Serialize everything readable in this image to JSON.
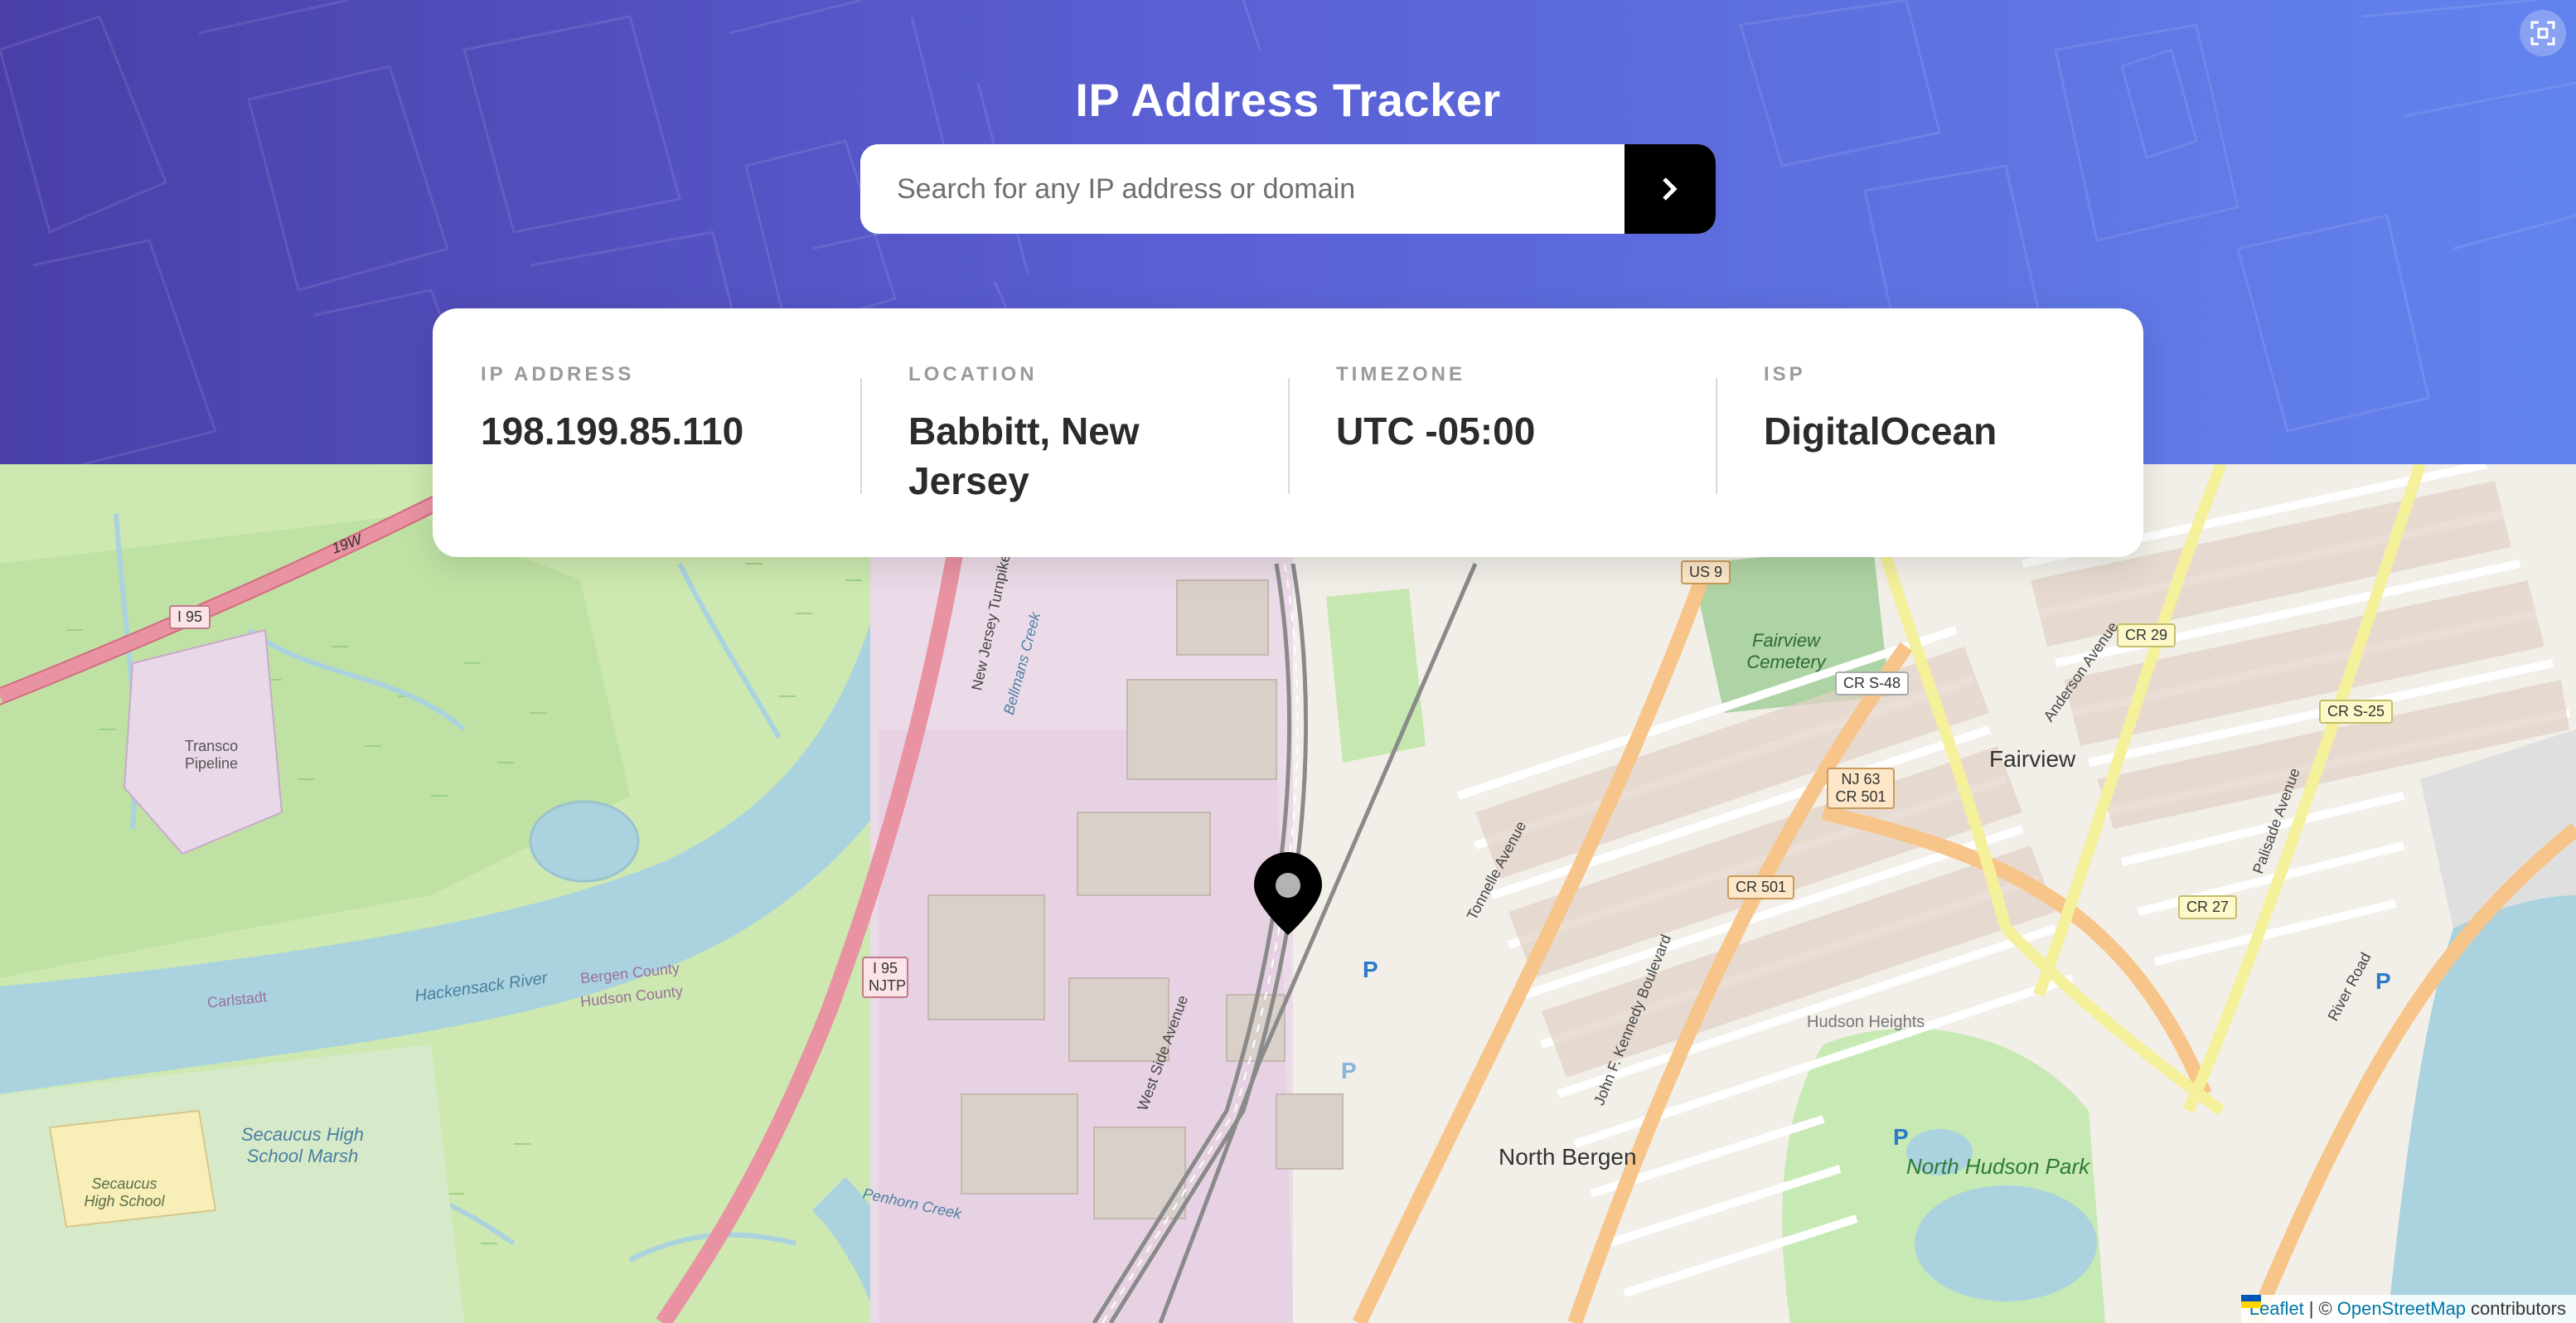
{
  "header": {
    "title": "IP Address Tracker",
    "search": {
      "placeholder": "Search for any IP address or domain",
      "value": "",
      "submit_icon": "chevron-right-icon"
    },
    "fullscreen_icon": "fullscreen-icon"
  },
  "info": {
    "ip": {
      "label": "IP ADDRESS",
      "value": "198.199.85.110"
    },
    "location": {
      "label": "LOCATION",
      "value": "Babbitt, New Jersey"
    },
    "timezone": {
      "label": "TIMEZONE",
      "value": "UTC -05:00"
    },
    "isp": {
      "label": "ISP",
      "value": "DigitalOcean"
    }
  },
  "map": {
    "marker_icon": "location-pin-icon",
    "labels": {
      "fairview": "Fairview",
      "north_bergen": "North Bergen",
      "north_hudson_park": "North Hudson Park",
      "hudson_heights": "Hudson Heights",
      "fairview_cemetery": "Fairview Cemetery",
      "secaucus_high_school": "Secaucus High School",
      "secaucus_high_school_marsh": "Secaucus High School Marsh",
      "transco_pipeline": "Transco Pipeline",
      "hackensack_river": "Hackensack River",
      "bergen_county": "Bergen County",
      "hudson_county": "Hudson County",
      "carlstadt": "Carlstadt",
      "tonnelle_avenue": "Tonnelle Avenue",
      "kennedy_boulevard": "John F. Kennedy Boulevard",
      "anderson_avenue": "Anderson Avenue",
      "palisade_avenue": "Palisade Avenue",
      "river_road": "River Road",
      "west_side_avenue": "West Side Avenue",
      "new_jersey_turnpike": "New Jersey Turnpike",
      "bellmans_creek": "Bellmans Creek",
      "penhorn_creek": "Penhorn Creek"
    },
    "shields": {
      "i95": "I 95",
      "i95_njtp": "I 95 NJTP",
      "us9": "US 9",
      "cr_s48": "CR S-48",
      "nj63": "NJ 63 CR 501",
      "cr501": "CR 501",
      "cr29": "CR 29",
      "cr_s25": "CR S-25",
      "cr27": "CR 27",
      "r19w": "19W"
    },
    "parking": "P"
  },
  "attribution": {
    "leaflet": "Leaflet",
    "separator": "|",
    "copyright": "©",
    "osm": "OpenStreetMap",
    "contributors": "contributors"
  }
}
